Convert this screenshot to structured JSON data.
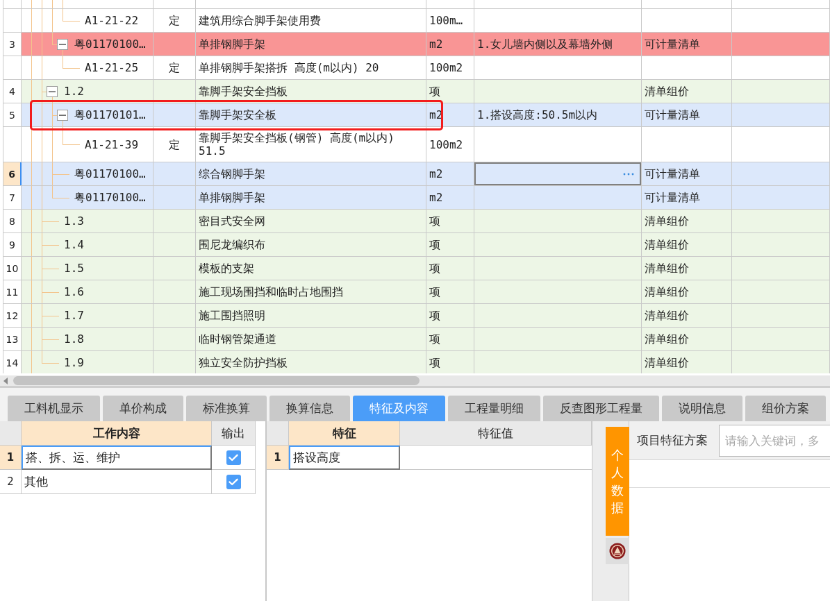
{
  "bill_table": {
    "rows": [
      {
        "children": [
          {
            "children": [
              {
                "children": [
                  {
                    "children": [
                      {
                        "code": "A1-21-22",
                        "type": "定",
                        "name": "建筑用综合脚手架使用费",
                        "unit": "100m…",
                        "kind": "quota",
                        "selected": false,
                        "flagged": false,
                        "outlined": false
                      }
                    ]
                  },
                  {
                    "number": "3",
                    "code": "粤01170100…",
                    "name": "单排钢脚手架",
                    "unit": "m2",
                    "feature": "1.女儿墙内侧以及幕墙外侧",
                    "category": "可计量清单",
                    "kind": "measure",
                    "expanded": true,
                    "selected": false,
                    "flagged": true,
                    "outlined": false,
                    "children": [
                      {
                        "code": "A1-21-25",
                        "type": "定",
                        "name": "单排钢脚手架搭拆 高度(m以内) 20",
                        "unit": "100m2",
                        "kind": "quota",
                        "selected": false,
                        "flagged": false,
                        "outlined": false
                      }
                    ]
                  }
                ]
              },
              {
                "number": "4",
                "code": "1.2",
                "name": "靠脚手架安全挡板",
                "unit": "项",
                "category": "清单组价",
                "kind": "group",
                "expanded": true,
                "selected": false,
                "flagged": false,
                "outlined": false,
                "children": [
                  {
                    "number": "5",
                    "code": "粤01170101…",
                    "name": "靠脚手架安全板",
                    "unit": "m2",
                    "feature": "1.搭设高度:50.5m以内",
                    "category": "可计量清单",
                    "kind": "measure",
                    "expanded": true,
                    "selected": false,
                    "flagged": false,
                    "outlined": true,
                    "children": [
                      {
                        "code": "A1-21-39",
                        "type": "定",
                        "name": "靠脚手架安全挡板(钢管) 高度(m以内) 51.5",
                        "unit": "100m2",
                        "kind": "quota",
                        "selected": false,
                        "flagged": false,
                        "outlined": false
                      }
                    ]
                  },
                  {
                    "number": "6",
                    "code": "粤01170100…",
                    "name": "综合钢脚手架",
                    "unit": "m2",
                    "category": "可计量清单",
                    "kind": "measure",
                    "selected": true,
                    "flagged": false,
                    "outlined": false
                  },
                  {
                    "number": "7",
                    "code": "粤01170100…",
                    "name": "单排钢脚手架",
                    "unit": "m2",
                    "category": "可计量清单",
                    "kind": "measure",
                    "selected": false,
                    "flagged": false,
                    "outlined": false
                  }
                ]
              },
              {
                "number": "8",
                "code": "1.3",
                "name": "密目式安全网",
                "unit": "项",
                "category": "清单组价",
                "kind": "group",
                "selected": false,
                "flagged": false,
                "outlined": false
              },
              {
                "number": "9",
                "code": "1.4",
                "name": "围尼龙编织布",
                "unit": "项",
                "category": "清单组价",
                "kind": "group",
                "selected": false,
                "flagged": false,
                "outlined": false
              },
              {
                "number": "10",
                "code": "1.5",
                "name": "模板的支架",
                "unit": "项",
                "category": "清单组价",
                "kind": "group",
                "selected": false,
                "flagged": false,
                "outlined": false
              },
              {
                "number": "11",
                "code": "1.6",
                "name": "施工现场围挡和临时占地围挡",
                "unit": "项",
                "category": "清单组价",
                "kind": "group",
                "selected": false,
                "flagged": false,
                "outlined": false
              },
              {
                "number": "12",
                "code": "1.7",
                "name": "施工围挡照明",
                "unit": "项",
                "category": "清单组价",
                "kind": "group",
                "selected": false,
                "flagged": false,
                "outlined": false
              },
              {
                "number": "13",
                "code": "1.8",
                "name": "临时钢管架通道",
                "unit": "项",
                "category": "清单组价",
                "kind": "group",
                "selected": false,
                "flagged": false,
                "outlined": false
              },
              {
                "number": "14",
                "code": "1.9",
                "name": "独立安全防护挡板",
                "unit": "项",
                "category": "清单组价",
                "kind": "group",
                "selected": false,
                "flagged": false,
                "outlined": false
              }
            ]
          }
        ]
      }
    ]
  },
  "detail_tabs": [
    {
      "label": "工料机显示",
      "selected": false
    },
    {
      "label": "单价构成",
      "selected": false
    },
    {
      "label": "标准换算",
      "selected": false
    },
    {
      "label": "换算信息",
      "selected": false
    },
    {
      "label": "特征及内容",
      "selected": true
    },
    {
      "label": "工程量明细",
      "selected": false
    },
    {
      "label": "反查图形工程量",
      "selected": false
    },
    {
      "label": "说明信息",
      "selected": false
    },
    {
      "label": "组价方案",
      "selected": false
    }
  ],
  "work_content": {
    "columns": [
      "工作内容",
      "输出"
    ],
    "rows": [
      {
        "number": "1",
        "content": "搭、拆、运、维护",
        "output": true,
        "selected": true
      },
      {
        "number": "2",
        "content": "其他",
        "output": true,
        "selected": false
      }
    ]
  },
  "features": {
    "columns": [
      "特征",
      "特征值"
    ],
    "rows": [
      {
        "number": "1",
        "feature": "搭设高度",
        "selected": true
      }
    ]
  },
  "feature_scheme": {
    "side_tab": "个人数据",
    "label": "项目特征方案",
    "search": {
      "placeholder": "请输入关键词，多"
    }
  }
}
